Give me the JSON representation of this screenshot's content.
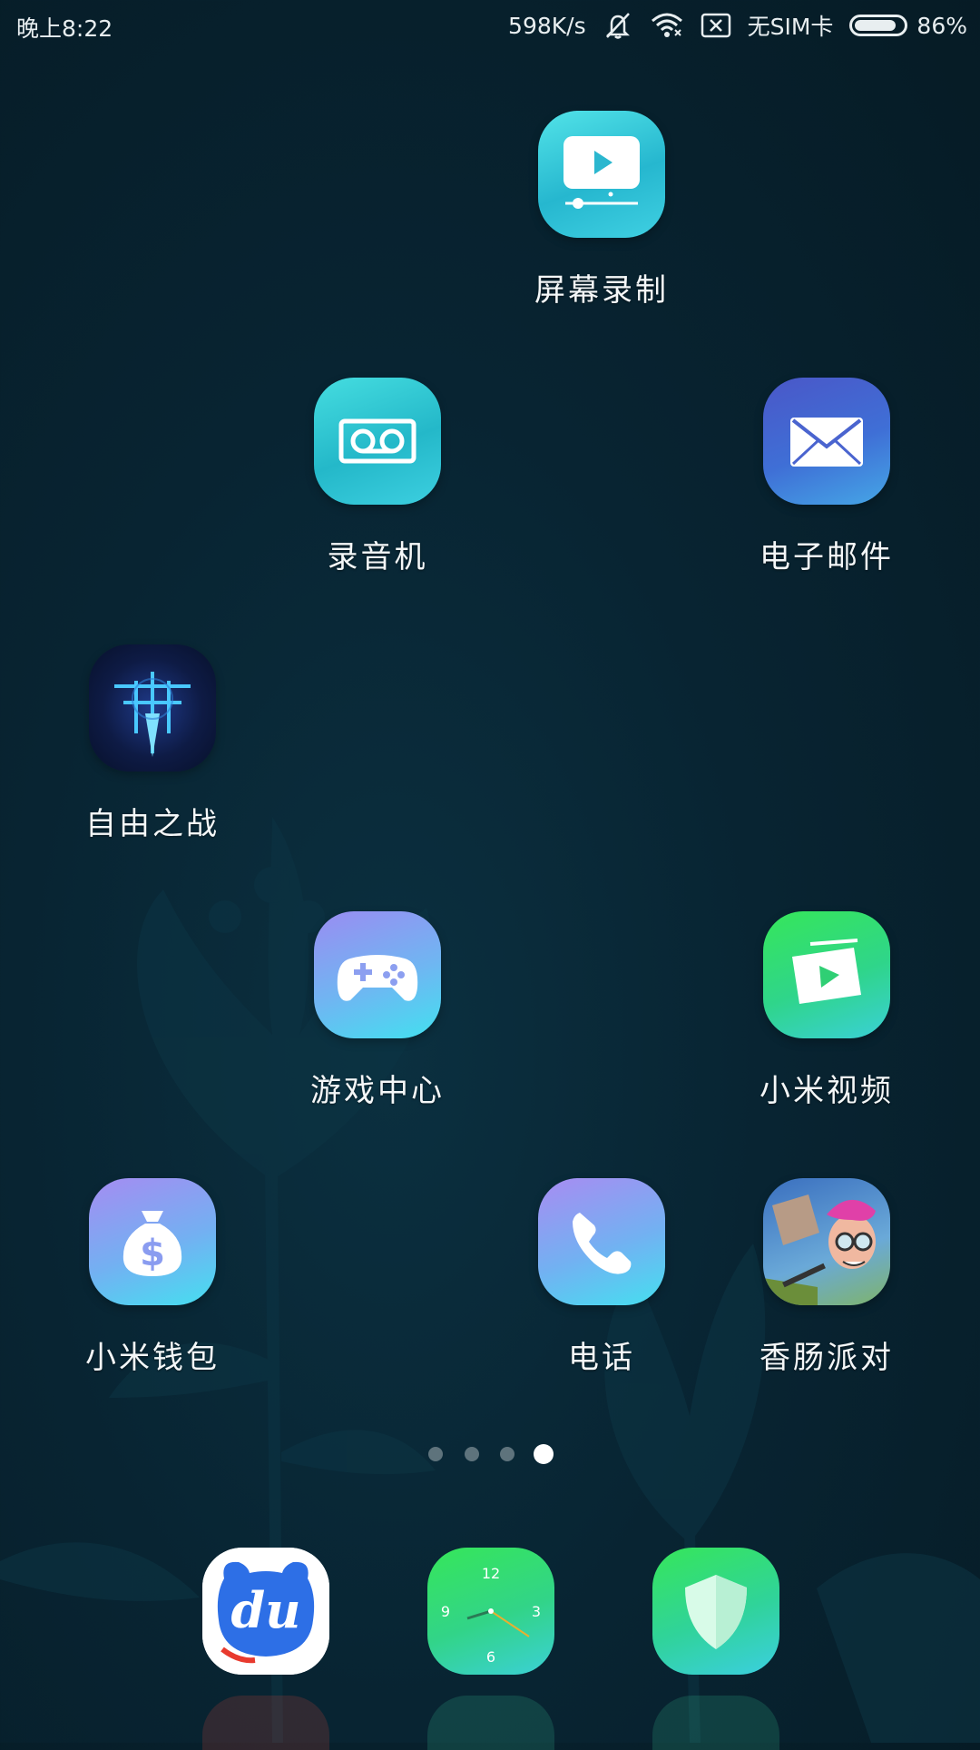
{
  "status_bar": {
    "time": "晚上8:22",
    "speed": "598K/s",
    "sim": "无SIM卡",
    "battery": "86%",
    "battery_level": 0.86
  },
  "apps": [
    {
      "id": "screen-record",
      "label": "屏幕录制",
      "icon": "screen-record-icon"
    },
    {
      "id": "recorder",
      "label": "录音机",
      "icon": "voicemail-tape-icon"
    },
    {
      "id": "email",
      "label": "电子邮件",
      "icon": "envelope-icon"
    },
    {
      "id": "freedom-war",
      "label": "自由之战",
      "icon": "game-sword-emblem-icon"
    },
    {
      "id": "game-center",
      "label": "游戏中心",
      "icon": "gamepad-icon"
    },
    {
      "id": "mi-video",
      "label": "小米视频",
      "icon": "video-play-icon"
    },
    {
      "id": "mi-wallet",
      "label": "小米钱包",
      "icon": "money-bag-icon"
    },
    {
      "id": "phone",
      "label": "电话",
      "icon": "phone-handset-icon"
    },
    {
      "id": "sausage-party",
      "label": "香肠派对",
      "icon": "cartoon-character-icon"
    }
  ],
  "clock_face": {
    "n12": "12",
    "n3": "3",
    "n6": "6",
    "n9": "9"
  },
  "baidu_logo_text": "du",
  "page_indicator": {
    "count": 4,
    "active": 3
  },
  "dock": [
    "baidu-app-icon",
    "clock-icon",
    "security-shield-icon"
  ],
  "colors": {
    "background": "#082432",
    "accent_cyan": "#3dd6e6",
    "green": "#2fe06a"
  }
}
